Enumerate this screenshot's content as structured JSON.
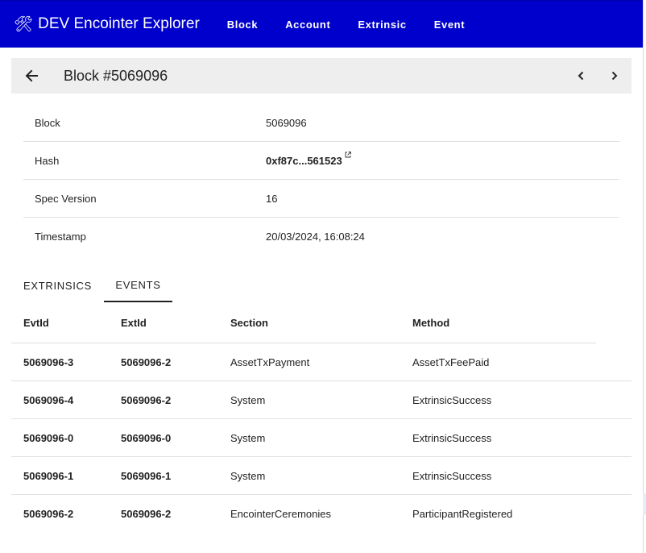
{
  "app": {
    "icon": "hammer-and-wrench-icon",
    "title": "DEV Encointer Explorer",
    "colors": {
      "appbar": "#0000cc",
      "header_bg": "#eeeeee"
    }
  },
  "nav": {
    "items": [
      {
        "label": "Block"
      },
      {
        "label": "Account"
      },
      {
        "label": "Extrinsic"
      },
      {
        "label": "Event"
      }
    ]
  },
  "header": {
    "title": "Block #5069096"
  },
  "details": {
    "rows": [
      {
        "label": "Block",
        "value": "5069096"
      },
      {
        "label": "Hash",
        "value": "0xf87c...561523"
      },
      {
        "label": "Spec Version",
        "value": "16"
      },
      {
        "label": "Timestamp",
        "value": "20/03/2024, 16:08:24"
      }
    ]
  },
  "tabs": [
    {
      "label": "EXTRINSICS",
      "active": false
    },
    {
      "label": "EVENTS",
      "active": true
    }
  ],
  "events_table": {
    "columns": [
      "EvtId",
      "ExtId",
      "Section",
      "Method"
    ],
    "rows": [
      [
        "5069096-3",
        "5069096-2",
        "AssetTxPayment",
        "AssetTxFeePaid"
      ],
      [
        "5069096-4",
        "5069096-2",
        "System",
        "ExtrinsicSuccess"
      ],
      [
        "5069096-0",
        "5069096-0",
        "System",
        "ExtrinsicSuccess"
      ],
      [
        "5069096-1",
        "5069096-1",
        "System",
        "ExtrinsicSuccess"
      ],
      [
        "5069096-2",
        "5069096-2",
        "EncointerCeremonies",
        "ParticipantRegistered"
      ]
    ]
  }
}
